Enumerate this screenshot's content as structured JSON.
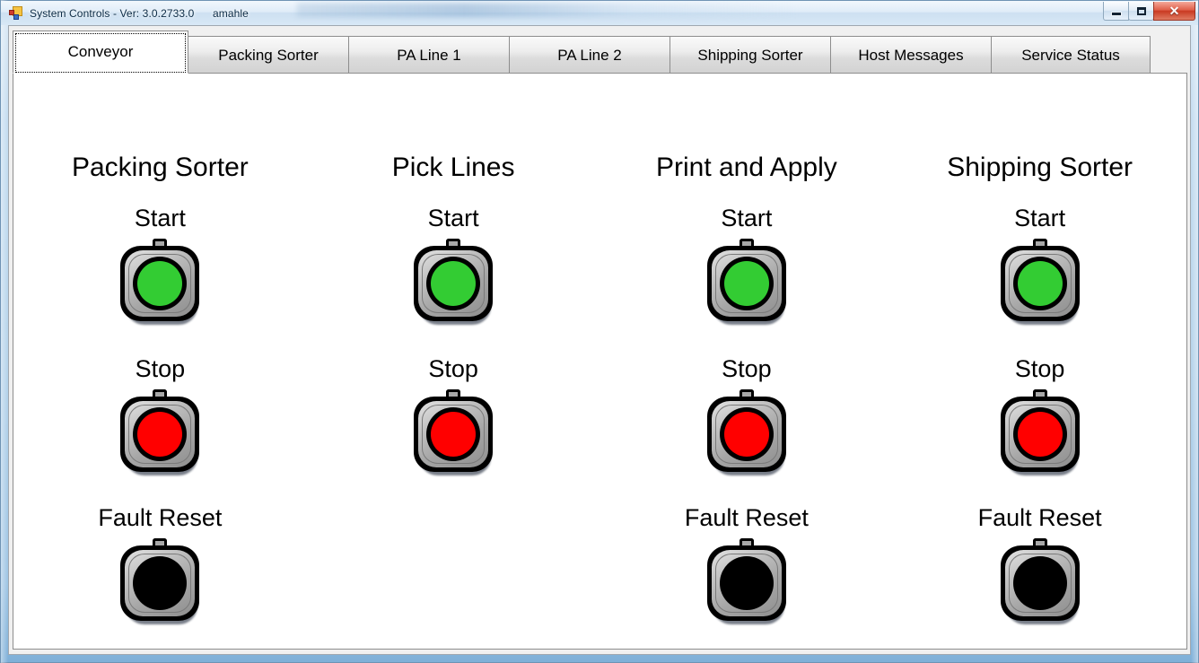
{
  "window": {
    "title": "System Controls - Ver: 3.0.2733.0      amahle",
    "app_icon": "winforms-app-icon",
    "minimize_label": "",
    "maximize_label": "",
    "close_label": "✕"
  },
  "tabs": [
    {
      "label": "Conveyor",
      "active": true
    },
    {
      "label": "Packing Sorter",
      "active": false
    },
    {
      "label": "PA Line 1",
      "active": false
    },
    {
      "label": "PA Line 2",
      "active": false
    },
    {
      "label": "Shipping Sorter",
      "active": false
    },
    {
      "label": "Host Messages",
      "active": false
    },
    {
      "label": "Service Status",
      "active": false
    }
  ],
  "colors": {
    "start_green": "#33cc33",
    "stop_red": "#ff0000",
    "fault_black": "#000000",
    "bezel_gray": "#b4b4b4"
  },
  "columns": [
    {
      "title": "Packing Sorter",
      "controls": [
        {
          "label": "Start",
          "state": "green"
        },
        {
          "label": "Stop",
          "state": "red"
        },
        {
          "label": "Fault Reset",
          "state": "black"
        }
      ]
    },
    {
      "title": "Pick Lines",
      "controls": [
        {
          "label": "Start",
          "state": "green"
        },
        {
          "label": "Stop",
          "state": "red"
        }
      ]
    },
    {
      "title": "Print and Apply",
      "controls": [
        {
          "label": "Start",
          "state": "green"
        },
        {
          "label": "Stop",
          "state": "red"
        },
        {
          "label": "Fault Reset",
          "state": "black"
        }
      ]
    },
    {
      "title": "Shipping Sorter",
      "controls": [
        {
          "label": "Start",
          "state": "green"
        },
        {
          "label": "Stop",
          "state": "red"
        },
        {
          "label": "Fault Reset",
          "state": "black"
        }
      ]
    }
  ]
}
